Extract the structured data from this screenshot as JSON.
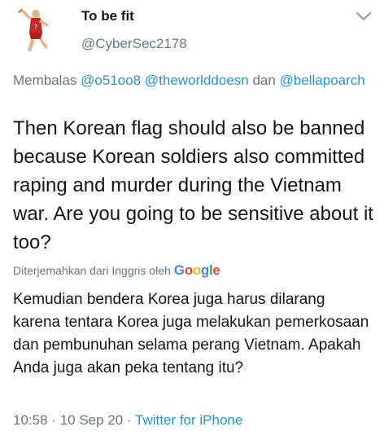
{
  "user": {
    "display_name": "To be fit",
    "handle": "@CyberSec2178"
  },
  "reply_context": {
    "prefix": "Membalas",
    "mention_1": "@o51oo8",
    "mention_2": "@theworlddoesn",
    "conjunction": "dan",
    "mention_3": "@bellapoarch"
  },
  "tweet": {
    "text": "Then Korean flag should also be banned because Korean soldiers also committed raping and murder during the Vietnam war. Are you going to be sensitive about it too?"
  },
  "translation": {
    "label": "Diterjemahkan dari Inggris oleh",
    "provider": "Google",
    "text": "Kemudian bendera Korea juga harus dilarang karena tentara Korea juga melakukan pemerkosaan dan pembunuhan selama perang Vietnam. Apakah Anda juga akan peka tentang itu?"
  },
  "meta": {
    "time": "10:58",
    "separator": "·",
    "date": "10 Sep 20",
    "source": "Twitter for iPhone"
  },
  "icons": {
    "avatar": "basketball-player-avatar",
    "menu": "chevron-down-icon"
  },
  "colors": {
    "text": "#14171a",
    "secondary": "#657786",
    "link": "#1b95e0"
  }
}
